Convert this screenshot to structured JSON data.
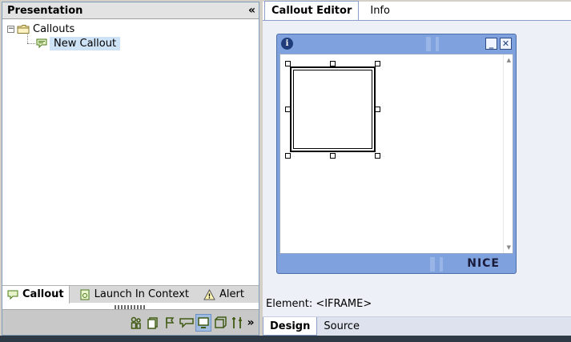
{
  "presentation_pane": {
    "title": "Presentation",
    "collapse_label": "«",
    "tree": {
      "root": {
        "label": "Callouts",
        "expander": "−"
      },
      "child": {
        "label": "New Callout"
      }
    },
    "bottom_tabs": [
      {
        "label": "Callout",
        "icon": "callout-icon"
      },
      {
        "label": "Launch In Context",
        "icon": "launch-icon"
      },
      {
        "label": "Alert",
        "icon": "alert-icon"
      }
    ],
    "toolbar_overflow": "»"
  },
  "editor_pane": {
    "tabs": [
      {
        "label": "Callout Editor"
      },
      {
        "label": "Info"
      }
    ],
    "callout_window": {
      "info_glyph": "i",
      "minimize_glyph": "_",
      "close_glyph": "✕",
      "logo_text": "NICE"
    },
    "element_label": "Element: <IFRAME>",
    "mode_tabs": [
      {
        "label": "Design"
      },
      {
        "label": "Source"
      }
    ]
  },
  "colors": {
    "window_frame": "#7fa2de",
    "selection": "#cfe3f7",
    "toolbar_icon": "#3f5a12"
  }
}
